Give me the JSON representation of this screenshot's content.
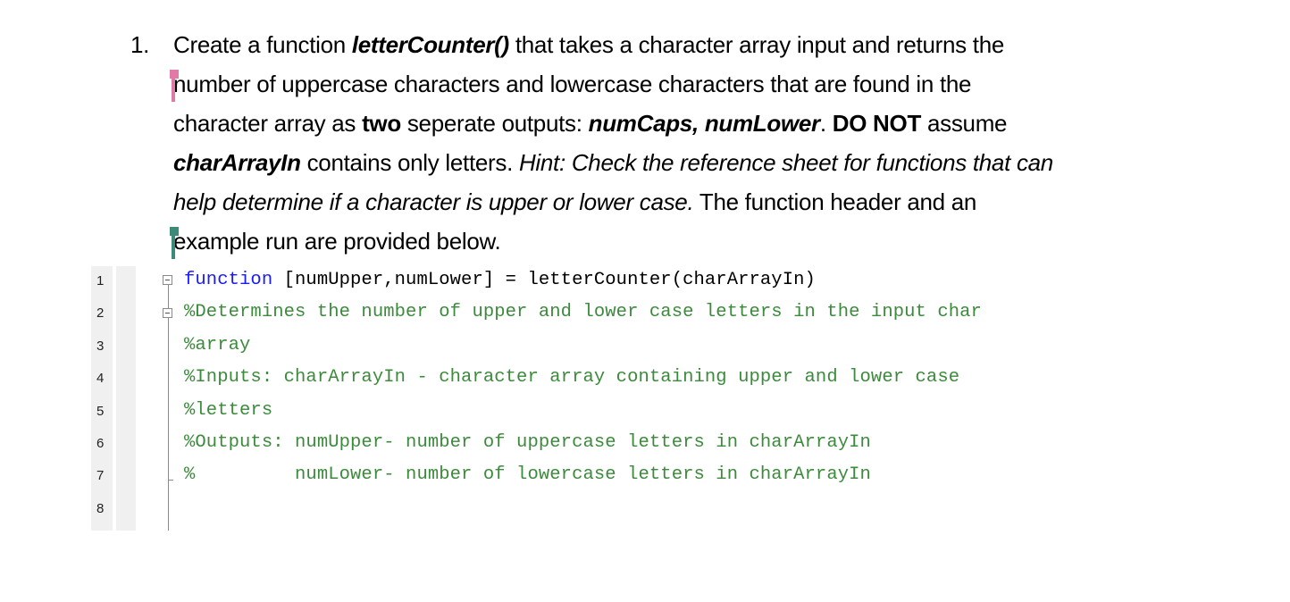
{
  "question": {
    "number": "1.",
    "lines": [
      {
        "a": "Create a function ",
        "b": "letterCounter()",
        "c": " that takes a character array input and returns the"
      },
      {
        "a": "number of uppercase characters and lowercase characters that are found in the"
      },
      {
        "a": "character array as ",
        "b": "two",
        "c": " seperate outputs: ",
        "d": "numCaps, numLower",
        "e": ".  ",
        "f": "DO NOT",
        "g": " assume"
      },
      {
        "a": "charArrayIn",
        "b": " contains only letters. ",
        "c": "Hint: Check the reference sheet for functions that can"
      },
      {
        "a": "help determine if a character is upper or lower case.",
        "b": "  The function header and an"
      },
      {
        "a": "example run are provided below."
      }
    ]
  },
  "editor": {
    "line_numbers": [
      "1",
      "2",
      "3",
      "4",
      "5",
      "6",
      "7",
      "8"
    ],
    "lines": [
      {
        "keyword": "function",
        "text": " [numUpper,numLower] = letterCounter(charArrayIn)"
      },
      {
        "comment": "%Determines the number of upper and lower case letters in the input char"
      },
      {
        "comment": "%array"
      },
      {
        "comment": "%Inputs: charArrayIn - character array containing upper and lower case"
      },
      {
        "comment": "%letters"
      },
      {
        "comment": "%Outputs: numUpper- number of uppercase letters in charArrayIn"
      },
      {
        "comment": "%         numLower- number of lowercase letters in charArrayIn"
      },
      {
        "comment": ""
      }
    ],
    "colors": {
      "keyword": "#1a1aff",
      "comment": "#3c8a3c",
      "text": "#000000"
    }
  }
}
